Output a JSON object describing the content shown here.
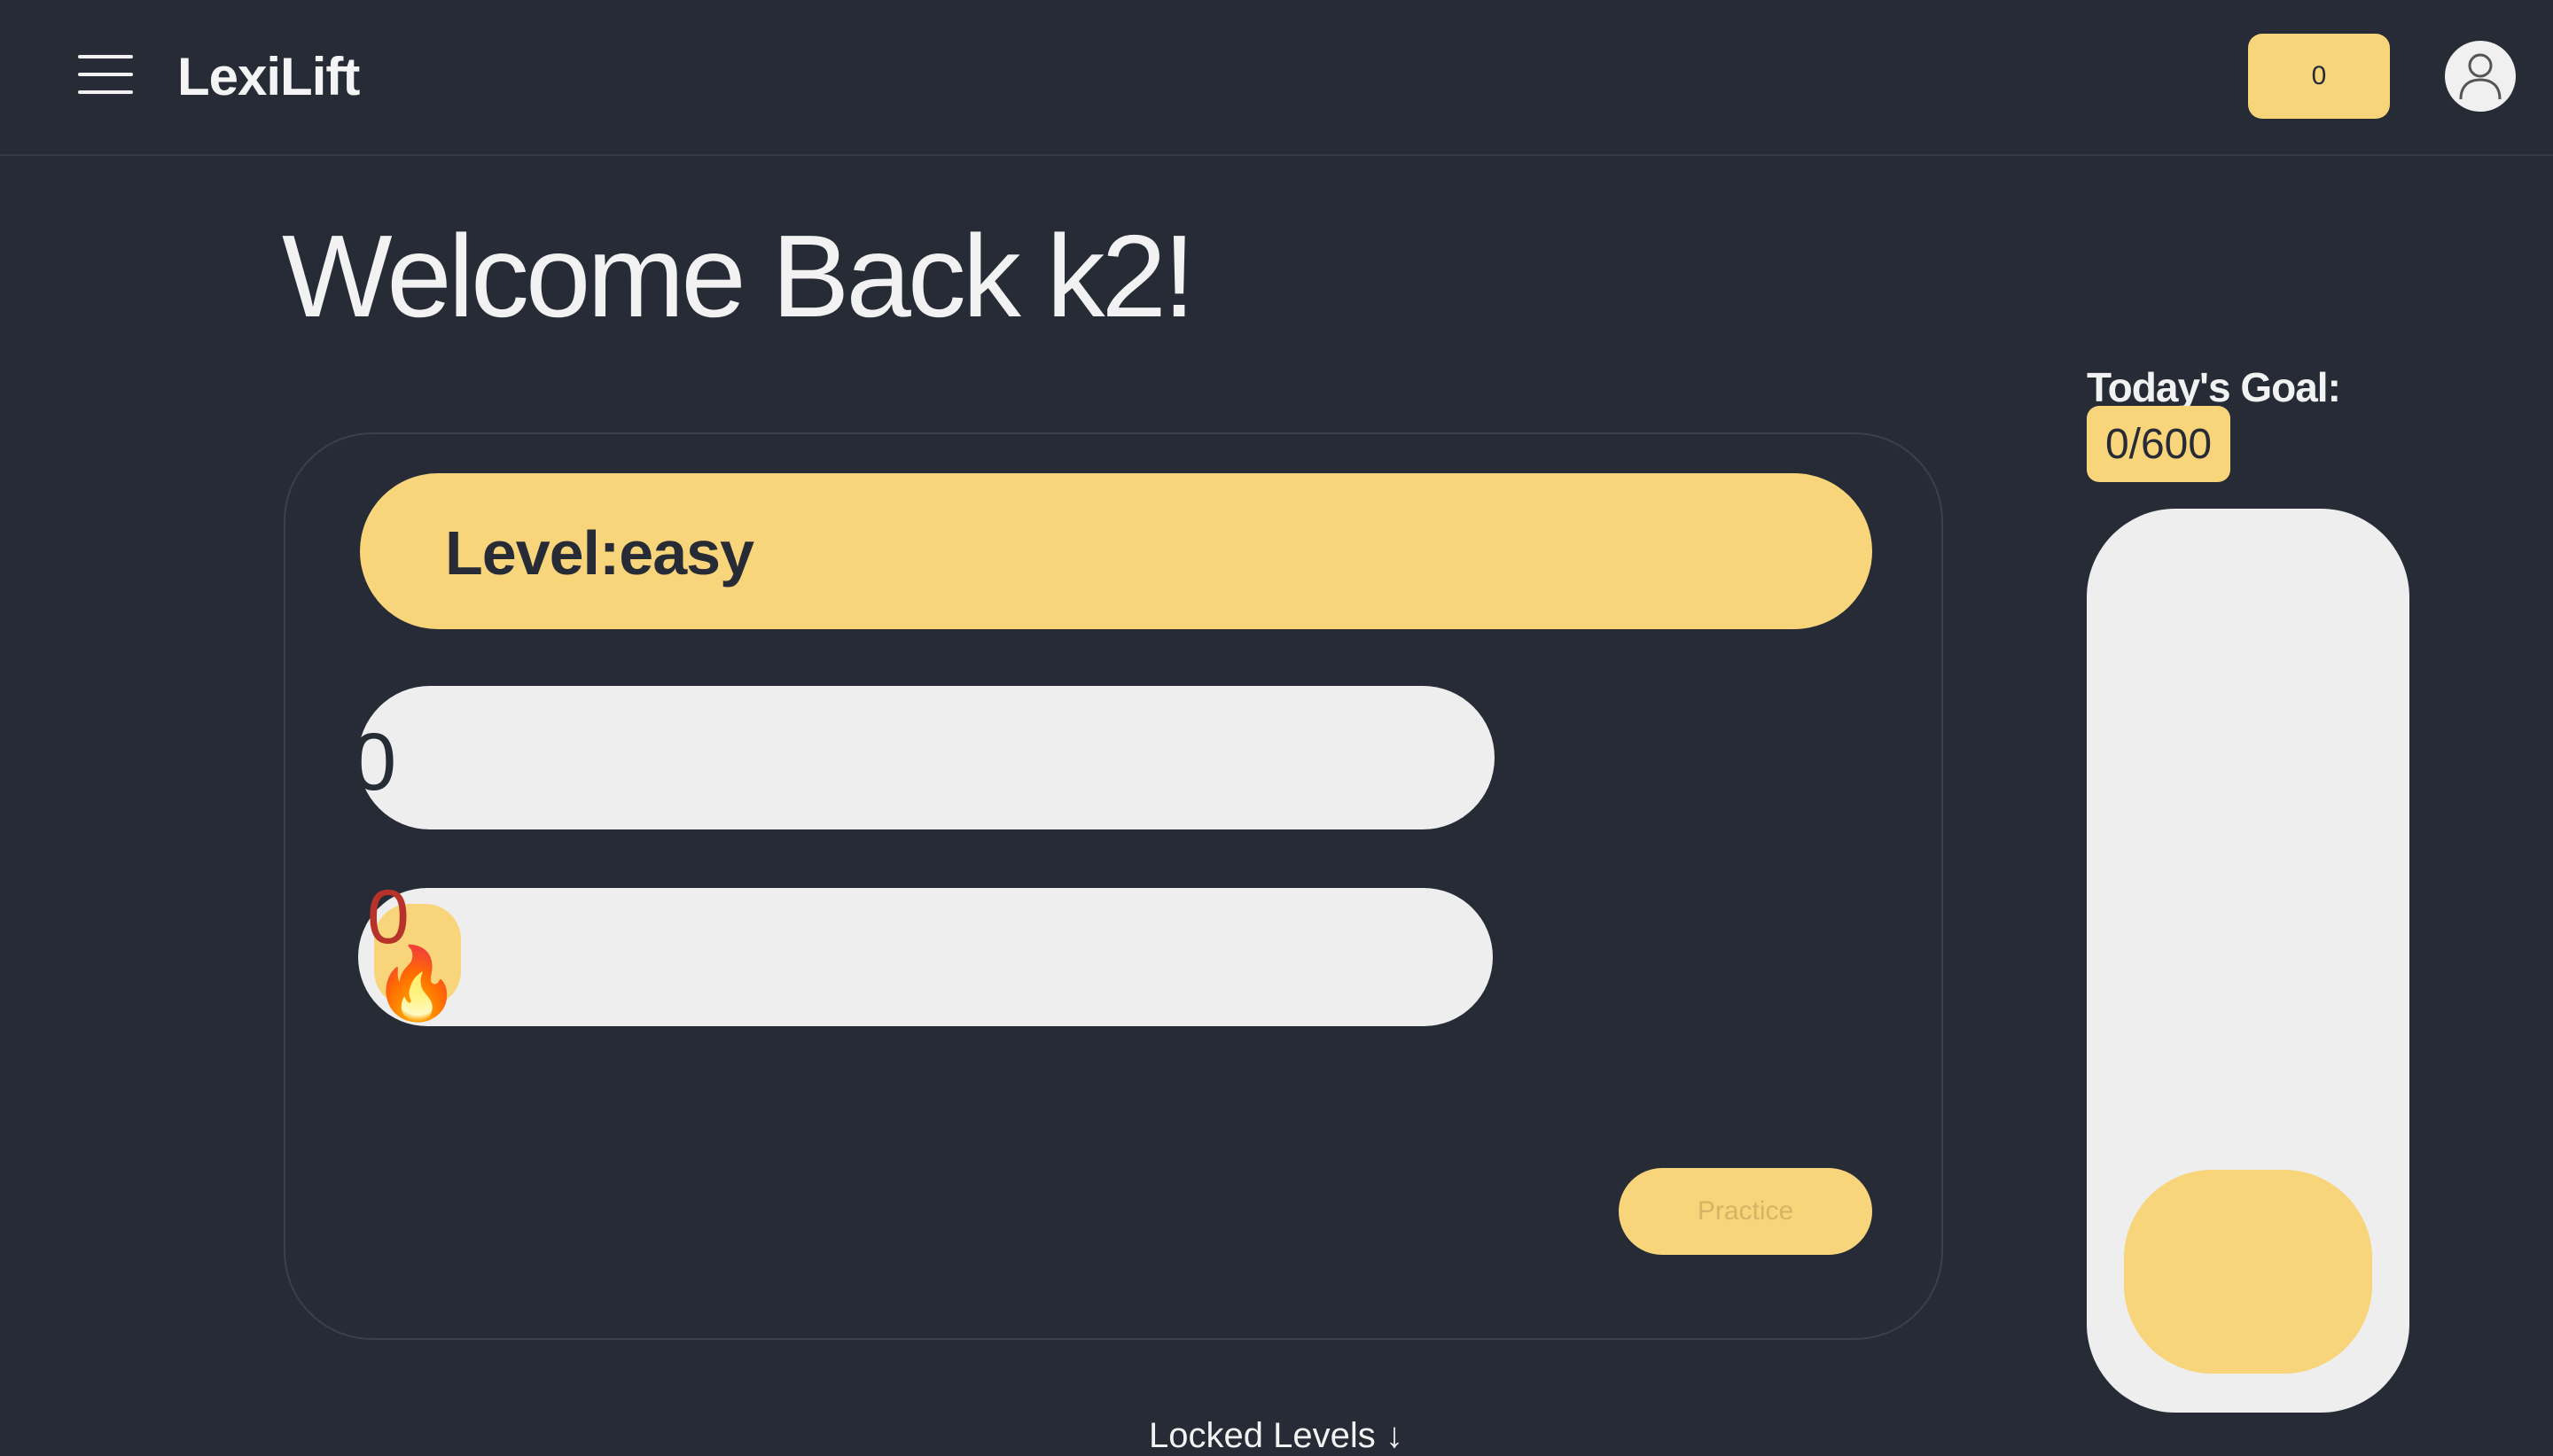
{
  "header": {
    "brand": "LexiLift",
    "score": "0"
  },
  "welcome": "Welcome Back k2!",
  "level_card": {
    "level_label": "Level:easy",
    "progress_value": "0",
    "streak_value": "0",
    "streak_icon": "🔥",
    "practice_label": "Practice"
  },
  "goal": {
    "label": "Today's Goal:",
    "value": "0/600"
  },
  "locked_levels": "Locked Levels ↓",
  "colors": {
    "background": "#262b36",
    "accent": "#f8d57b",
    "track": "#eeeeee",
    "streak_text": "#b7332a"
  }
}
